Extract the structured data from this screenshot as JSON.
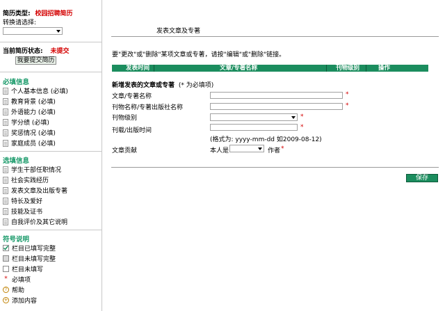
{
  "sidebar": {
    "resume_type_label": "简历类型:",
    "resume_type_value": "校园招聘简历",
    "switch_label": "转换请选择:",
    "status_label": "当前简历状态:",
    "status_value": "未提交",
    "submit_button": "我要提交简历",
    "required_title": "必填信息",
    "required_items": [
      {
        "label": "个人基本信息 (必填)"
      },
      {
        "label": "教育背景 (必填)"
      },
      {
        "label": "外语能力 (必填)"
      },
      {
        "label": "学分绩 (必填)"
      },
      {
        "label": "奖惩情况 (必填)"
      },
      {
        "label": "家庭成员 (必填)"
      }
    ],
    "optional_title": "选填信息",
    "optional_items": [
      {
        "label": "学生干部任职情况"
      },
      {
        "label": "社会实践经历"
      },
      {
        "label": "发表文章及出版专著"
      },
      {
        "label": "特长及爱好"
      },
      {
        "label": "技能及证书"
      },
      {
        "label": "自我评价及其它说明"
      }
    ],
    "legend_title": "符号说明",
    "legend_items": [
      {
        "label": "栏目已填写完整"
      },
      {
        "label": "栏目未填写完整"
      },
      {
        "label": "栏目未填写"
      },
      {
        "label": "必填项"
      },
      {
        "label": "帮助"
      },
      {
        "label": "添加内容"
      }
    ]
  },
  "main": {
    "page_title": "发表文章及专著",
    "instruction": "要\"更改\"或\"删除\"某项文章或专著，请按\"编辑\"或\"删除\"链接。",
    "table_headers": [
      "发表时间",
      "文章/专著名称",
      "刊物级别",
      "操作"
    ],
    "form_title": "新增发表的文章或专著",
    "form_note": "(* 为必填项)",
    "field_labels": {
      "title": "文章/专著名称",
      "publisher": "刊物名称/专著出版社名称",
      "level": "刊物级别",
      "date": "刊载/出版时间",
      "date_hint": "(格式为: yyyy-mm-dd 如2009-08-12)",
      "contribution": "文章贡献",
      "contrib_prefix": "本人是",
      "contrib_suffix": "作者"
    },
    "required_mark": "*",
    "save_button": "保存"
  }
}
